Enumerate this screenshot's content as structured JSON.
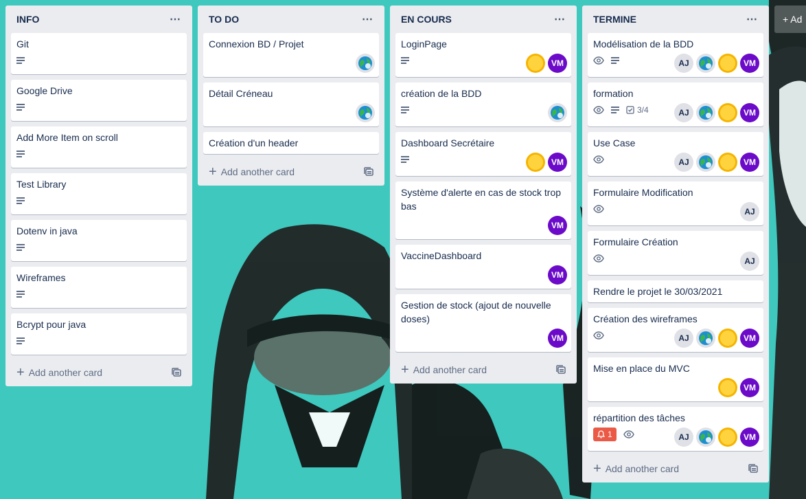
{
  "lists": [
    {
      "title": "INFO",
      "menu": "⋯",
      "add_label": "Add another card",
      "cards": [
        {
          "title": "Git"
        },
        {
          "title": "Google Drive"
        },
        {
          "title": "Add More Item on scroll"
        },
        {
          "title": "Test Library"
        },
        {
          "title": "Dotenv in java"
        },
        {
          "title": "Wireframes"
        },
        {
          "title": "Bcrypt pour java"
        }
      ]
    },
    {
      "title": "TO DO",
      "menu": "⋯",
      "add_label": "Add another card",
      "cards": [
        {
          "title": "Connexion BD / Projet"
        },
        {
          "title": "Détail Créneau"
        },
        {
          "title": "Création d'un header"
        }
      ]
    },
    {
      "title": "EN COURS",
      "menu": "⋯",
      "add_label": "Add another card",
      "cards": [
        {
          "title": "LoginPage"
        },
        {
          "title": "création de la BDD"
        },
        {
          "title": "Dashboard Secrétaire"
        },
        {
          "title": "Système d'alerte en cas de stock trop bas"
        },
        {
          "title": "VaccineDashboard"
        },
        {
          "title": "Gestion de stock (ajout de nouvelle doses)"
        }
      ]
    },
    {
      "title": "TERMINE",
      "menu": "⋯",
      "add_label": "Add another card",
      "cards": [
        {
          "title": "Modélisation de la BDD"
        },
        {
          "title": "formation",
          "checklist": "3/4"
        },
        {
          "title": "Use Case"
        },
        {
          "title": "Formulaire Modification"
        },
        {
          "title": "Formulaire Création"
        },
        {
          "title": "Rendre le projet le 30/03/2021"
        },
        {
          "title": "Création des wireframes"
        },
        {
          "title": "Mise en place du MVC"
        },
        {
          "title": "répartition des tâches",
          "notification": "1"
        }
      ]
    }
  ],
  "members": {
    "aj": "AJ",
    "vm": "VM"
  },
  "add_list_label": "+ Ad",
  "colors": {
    "board_bg": "#3fc8be",
    "vm": "#6b0ac9",
    "notification": "#eb5a46"
  }
}
